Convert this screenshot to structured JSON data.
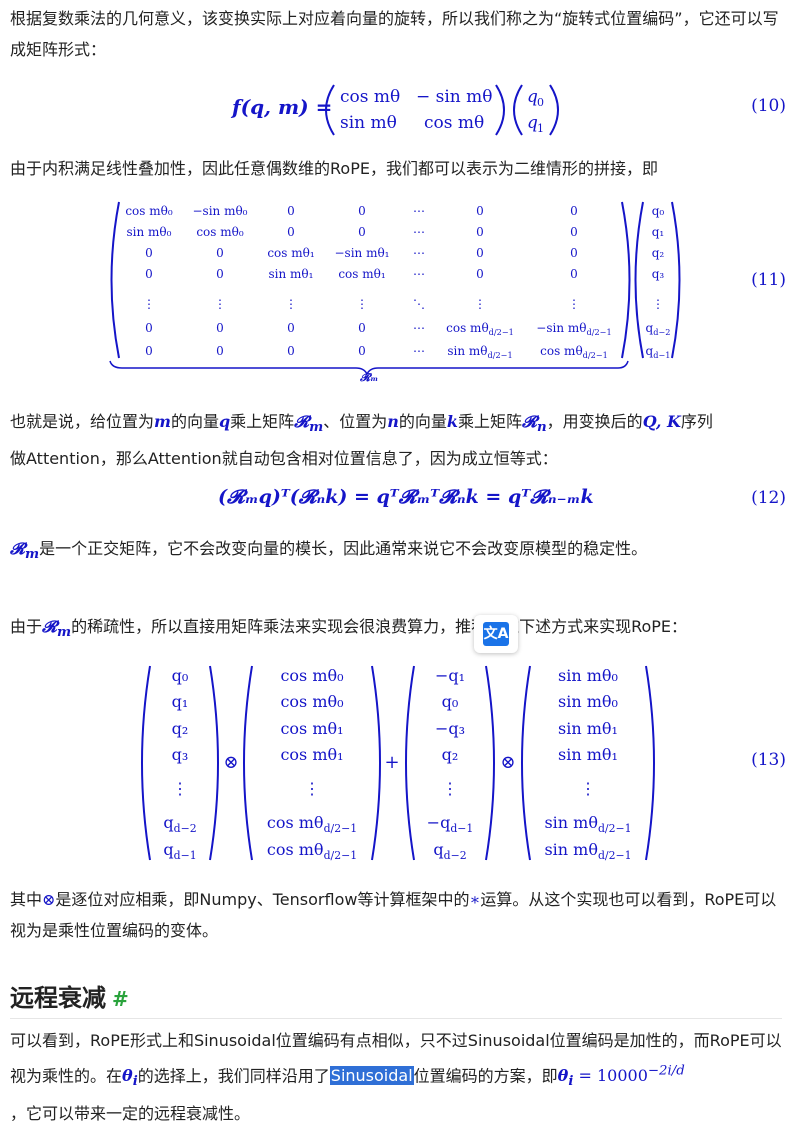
{
  "paragraphs": {
    "p1": "根据复数乘法的几何意义，该变换实际上对应着向量的旋转，所以我们称之为“旋转式位置编码”，它还可以写成矩阵形式：",
    "p2": "由于内积满足线性叠加性，因此任意偶数维的RoPE，我们都可以表示为二维情形的拼接，即",
    "p3_a": "也就是说，给位置为",
    "p3_b": "的向量",
    "p3_c": "乘上矩阵",
    "p3_d": "、位置为",
    "p3_e": "的向量",
    "p3_f": "乘上矩阵",
    "p3_g": "，用变换后的",
    "p3_h": "序列",
    "p3_line2": "做Attention，那么Attention就自动包含相对位置信息了，因为成立恒等式：",
    "p4_b": "是一个正交矩阵，它不会改变向量的模长，因此通常来说它不会改变原模型的稳定性。",
    "p5_a": "由于",
    "p5_b": "的稀疏性，所以直接用矩阵乘法来实现会很浪费算力，推荐通过下述方式来实现RoPE：",
    "p6_a": "其中",
    "p6_b": "是逐位对应相乘，即Numpy、Tensorflow等计算框架中的",
    "p6_c": "运算。从这个实现也可以看到，RoPE可以视为是乘性位置编码的变体。",
    "p7_a": "可以看到，RoPE形式上和Sinusoidal位置编码有点相似，只不过Sinusoidal位置编码是加性的，而RoPE可以视为乘性的。在",
    "p7_b": "的选择上，我们同样沿用了",
    "p7_hl": "Sinusoidal",
    "p7_c": "位置编码的方案，即",
    "p7_d": "，它可以带来一定的远程衰减性。"
  },
  "math": {
    "var_m": "m",
    "var_q": "q",
    "var_n": "n",
    "var_k": "k",
    "R_m": "𝓡",
    "R_m_sub": "m",
    "R_n_sub": "n",
    "QK": "Q, K",
    "theta_i": "θ",
    "theta_sub": "i",
    "theta_formula": "= 10000",
    "theta_exp": "−2i/d",
    "otimes": "⊗",
    "ast": "∗"
  },
  "equations": {
    "eq10_lhs": "f(q, m) =",
    "eq10_m11": "cos mθ",
    "eq10_m12": "− sin mθ",
    "eq10_m21": "sin mθ",
    "eq10_m22": "cos mθ",
    "eq10_v1": "q",
    "eq10_v1s": "0",
    "eq10_v2": "q",
    "eq10_v2s": "1",
    "eq12_text": "(𝓡ₘq)ᵀ(𝓡ₙk) = qᵀ𝓡ₘᵀ𝓡ₙk = qᵀ𝓡ₙ₋ₘk"
  },
  "eq_numbers": {
    "n10": "(10)",
    "n11": "(11)",
    "n12": "(12)",
    "n13": "(13)"
  },
  "eq11_matrix": [
    [
      "cos mθ₀",
      "−sin mθ₀",
      "0",
      "0",
      "⋯",
      "0",
      "0"
    ],
    [
      "sin mθ₀",
      "cos mθ₀",
      "0",
      "0",
      "⋯",
      "0",
      "0"
    ],
    [
      "0",
      "0",
      "cos mθ₁",
      "−sin mθ₁",
      "⋯",
      "0",
      "0"
    ],
    [
      "0",
      "0",
      "sin mθ₁",
      "cos mθ₁",
      "⋯",
      "0",
      "0"
    ],
    [
      "⋮",
      "⋮",
      "⋮",
      "⋮",
      "⋱",
      "⋮",
      "⋮"
    ],
    [
      "0",
      "0",
      "0",
      "0",
      "⋯",
      "cos mθ_{d/2−1}",
      "−sin mθ_{d/2−1}"
    ],
    [
      "0",
      "0",
      "0",
      "0",
      "⋯",
      "sin mθ_{d/2−1}",
      "cos mθ_{d/2−1}"
    ]
  ],
  "eq11_vector": [
    "q₀",
    "q₁",
    "q₂",
    "q₃",
    "⋮",
    "q_{d−2}",
    "q_{d−1}"
  ],
  "eq11_underbrace_label": "𝓡ₘ",
  "eq13_vectors": [
    [
      "q₀",
      "q₁",
      "q₂",
      "q₃",
      "⋮",
      "q_{d−2}",
      "q_{d−1}"
    ],
    [
      "cos mθ₀",
      "cos mθ₀",
      "cos mθ₁",
      "cos mθ₁",
      "⋮",
      "cos mθ_{d/2−1}",
      "cos mθ_{d/2−1}"
    ],
    [
      "−q₁",
      "q₀",
      "−q₃",
      "q₂",
      "⋮",
      "−q_{d−1}",
      "q_{d−2}"
    ],
    [
      "sin mθ₀",
      "sin mθ₀",
      "sin mθ₁",
      "sin mθ₁",
      "⋮",
      "sin mθ_{d/2−1}",
      "sin mθ_{d/2−1}"
    ]
  ],
  "eq13_ops": [
    "⊗",
    "+",
    "⊗"
  ],
  "heading": {
    "title": "远程衰减",
    "anchor": "#"
  },
  "colors": {
    "math": "#1515c8",
    "heading_anchor": "#2aa33c",
    "selection": "#2f6fd6",
    "translate_button": "#1a73e8"
  },
  "translate_icon": {
    "name": "translate-icon",
    "glyph": "文A"
  }
}
